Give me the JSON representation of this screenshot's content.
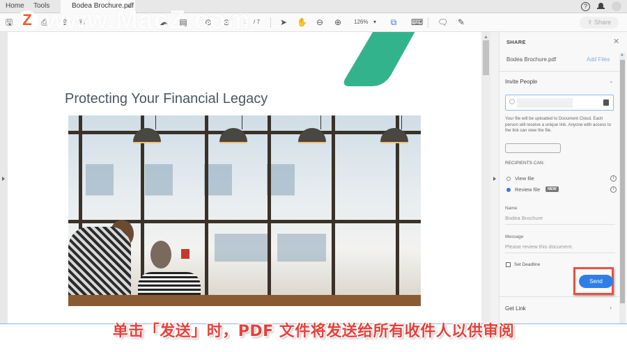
{
  "tabs": {
    "home": "Home",
    "tools": "Tools",
    "document": "Bodea Brochure.pdf",
    "close_glyph": "×"
  },
  "toolbar": {
    "page_current": "1",
    "page_total": "/ 7",
    "zoom": "126%",
    "zoom_arrow": "▾",
    "share_label": "Share"
  },
  "watermark": {
    "logo": "Z",
    "text": "www.MacZ.com"
  },
  "document": {
    "title": "Protecting Your Financial Legacy",
    "accent_color": "#32b38c"
  },
  "share_panel": {
    "title": "SHARE",
    "filename": "Bodea Brochure.pdf",
    "add_files": "Add Files",
    "invite_section": "Invite People",
    "info_text": "Your file will be uploaded to Document Cloud. Each person will receive a unique link. Anyone with access to the link can view the file.",
    "recipients_label": "RECIPIENTS CAN:",
    "options": [
      {
        "label": "View file",
        "selected": false
      },
      {
        "label": "Review file",
        "selected": true,
        "badge": "NEW"
      }
    ],
    "name_label": "Name",
    "name_value": "Bodea Brochure",
    "message_label": "Message",
    "message_placeholder": "Please review this document.",
    "deadline_label": "Set Deadline",
    "deadline_checked": false,
    "send_label": "Send",
    "get_link": "Get Link",
    "send_color": "#2f7ee6",
    "highlight_color": "#ee4f3f"
  },
  "caption": "单击「发送」时，PDF 文件将发送给所有收件人以供审阅"
}
